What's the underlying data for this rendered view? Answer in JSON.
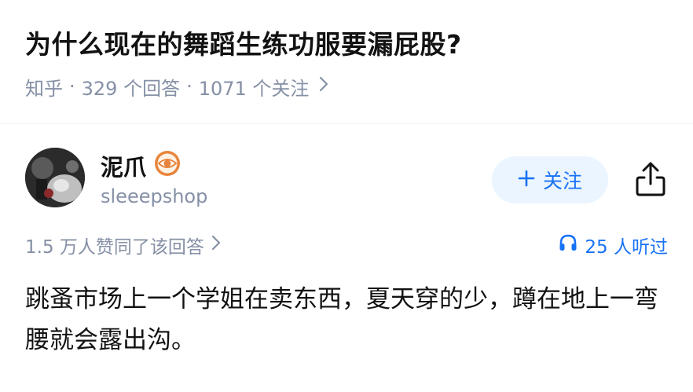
{
  "question": {
    "title": "为什么现在的舞蹈生练功服要漏屁股?",
    "source": "知乎",
    "answers_count": "329 个回答",
    "followers_count": "1071 个关注"
  },
  "author": {
    "name": "泥爪",
    "handle": "sleeepshop",
    "badge_icon": "eye-badge-icon",
    "follow_label": "关注"
  },
  "stats": {
    "likes_text": "1.5 万人赞同了该回答",
    "listens_text": "25 人听过"
  },
  "answer": {
    "text": "跳蚤市场上一个学姐在卖东西，夏天穿的少，蹲在地上一弯腰就会露出沟。"
  },
  "colors": {
    "accent": "#1772f6",
    "follow_bg": "#ebf5ff",
    "muted": "#8590a6",
    "badge": "#e8853c"
  }
}
